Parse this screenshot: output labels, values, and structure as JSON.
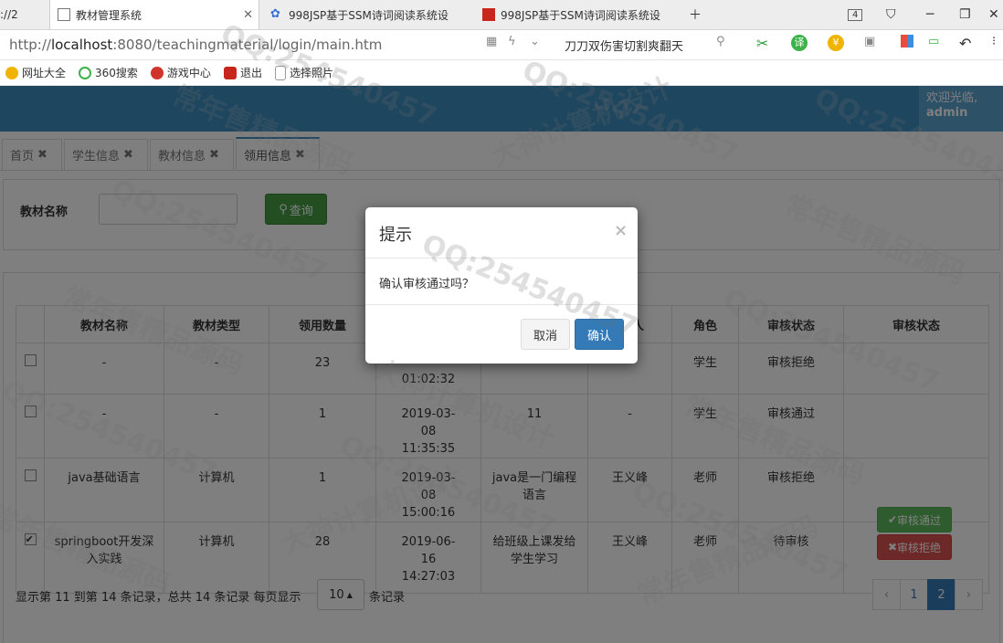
{
  "browser": {
    "tabs": [
      {
        "label": "://2",
        "active": false
      },
      {
        "label": "教材管理系统",
        "active": true
      },
      {
        "label": "998JSP基于SSM诗词阅读系统设",
        "active": false
      },
      {
        "label": "998JSP基于SSM诗词阅读系统设",
        "active": false
      }
    ],
    "tab_count": "4",
    "url_prefix": "http://",
    "url_host": "localhost",
    "url_rest": ":8080/teachingmaterial/login/main.htm",
    "search_hint": "刀刀双伤害切割爽翻天",
    "bookmarks": [
      "网址大全",
      "360搜索",
      "游戏中心",
      "退出",
      "选择照片"
    ]
  },
  "header": {
    "welcome_line1": "欢迎光临,",
    "welcome_line2": "admin"
  },
  "app_tabs": [
    "首页",
    "学生信息",
    "教材信息",
    "领用信息"
  ],
  "search": {
    "label": "教材名称",
    "button": "查询"
  },
  "table": {
    "headers": [
      "",
      "教材名称",
      "教材类型",
      "领用数量",
      "",
      "",
      "人",
      "角色",
      "审核状态",
      "审核状态"
    ],
    "rows": [
      {
        "checked": false,
        "name": "-",
        "type": "-",
        "qty": "23",
        "time": "01:02:32",
        "desc": "",
        "person": "",
        "role": "学生",
        "status": "审核拒绝"
      },
      {
        "checked": false,
        "name": "-",
        "type": "-",
        "qty": "1",
        "time": "2019-03-08 11:35:35",
        "desc": "11",
        "person": "-",
        "role": "学生",
        "status": "审核通过"
      },
      {
        "checked": false,
        "name": "java基础语言",
        "type": "计算机",
        "qty": "1",
        "time": "2019-03-08 15:00:16",
        "desc": "java是一门编程语言",
        "person": "王义峰",
        "role": "老师",
        "status": "审核拒绝"
      },
      {
        "checked": true,
        "name": "springboot开发深入实践",
        "type": "计算机",
        "qty": "28",
        "time": "2019-06-16 14:27:03",
        "desc": "给班级上课发给学生学习",
        "person": "王义峰",
        "role": "老师",
        "status": "待审核"
      }
    ],
    "approve_label": "审核通过",
    "reject_label": "审核拒绝"
  },
  "pagination": {
    "info": "显示第 11 到第 14 条记录，总共 14 条记录 每页显示",
    "page_size": "10",
    "tail": "条记录",
    "pages": [
      "‹",
      "1",
      "2",
      "›"
    ],
    "current": "2"
  },
  "modal": {
    "title": "提示",
    "message": "确认审核通过吗？",
    "cancel": "取消",
    "confirm": "确认"
  },
  "watermarks": [
    "QQ:254540457",
    "常年售精品源码",
    "大神计算机设计"
  ]
}
